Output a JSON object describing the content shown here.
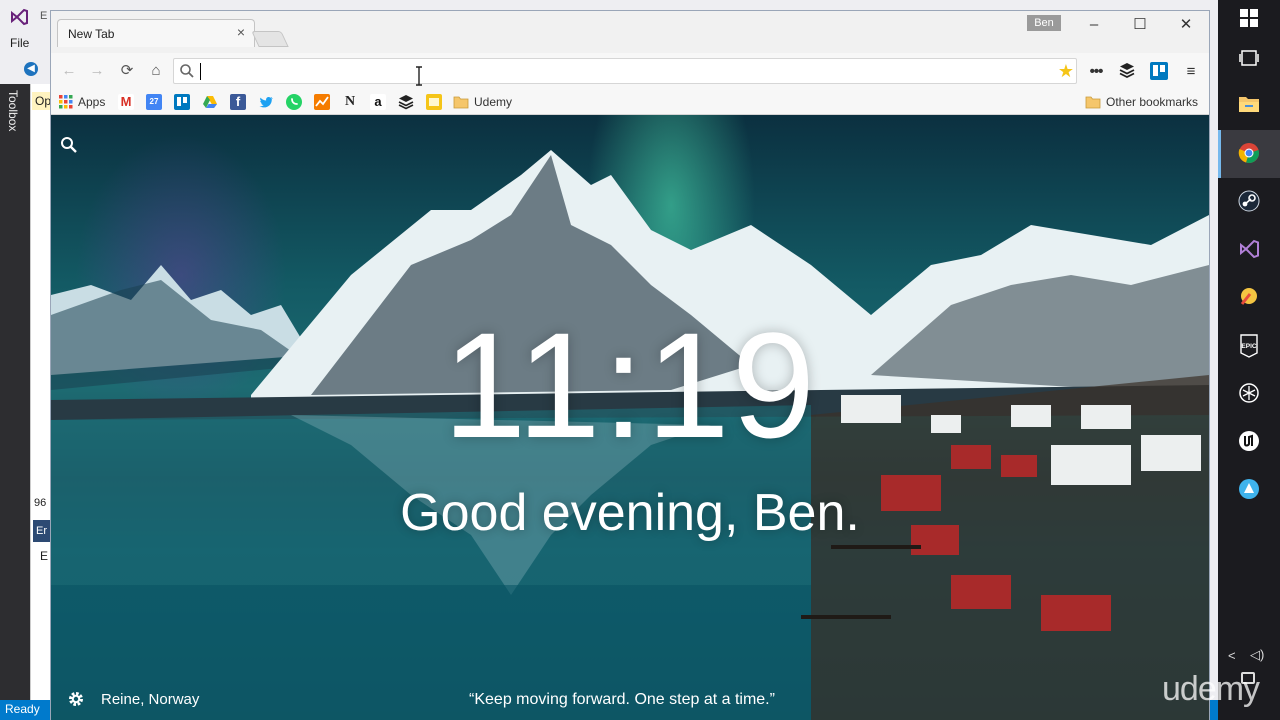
{
  "vs": {
    "partial_title": "E",
    "menu_file": "File",
    "toolbox": "Toolbox",
    "panel_tab": "Op",
    "line_number": "96",
    "error_tab": "Er",
    "error_item": "E",
    "status": "Ready"
  },
  "chrome": {
    "tab_title": "New Tab",
    "tab_close": "×",
    "profile_name": "Ben",
    "window_controls": {
      "minimize": "–",
      "maximize": "☐",
      "close": "✕"
    },
    "nav": {
      "back": "←",
      "forward": "→",
      "reload": "⟳",
      "home": "⌂"
    },
    "omnibox": {
      "value": "",
      "placeholder": ""
    },
    "star": "★",
    "menu": "≡",
    "bookmarks": [
      {
        "label": "Apps",
        "icon": "apps-grid-icon"
      },
      {
        "label": "",
        "icon": "gmail-icon"
      },
      {
        "label": "27",
        "icon": "calendar-icon"
      },
      {
        "label": "",
        "icon": "trello-icon"
      },
      {
        "label": "",
        "icon": "drive-icon"
      },
      {
        "label": "f",
        "icon": "facebook-icon"
      },
      {
        "label": "",
        "icon": "twitter-icon"
      },
      {
        "label": "",
        "icon": "whatsapp-icon"
      },
      {
        "label": "",
        "icon": "chart-icon"
      },
      {
        "label": "N",
        "icon": "notion-icon"
      },
      {
        "label": "a",
        "icon": "amazon-icon"
      },
      {
        "label": "",
        "icon": "buffer-icon"
      },
      {
        "label": "",
        "icon": "keep-icon"
      },
      {
        "label": "Udemy",
        "icon": "folder-icon"
      }
    ],
    "other_bookmarks": "Other bookmarks"
  },
  "momentum": {
    "time": "11:19",
    "greeting": "Good evening, Ben.",
    "location": "Reine, Norway",
    "quote": "“Keep moving forward. One step at a time.”"
  },
  "watermark": "udemy",
  "colors": {
    "vs_status": "#007acc",
    "taskbar": "#1b1b1f",
    "accent": "#76b9ed"
  }
}
